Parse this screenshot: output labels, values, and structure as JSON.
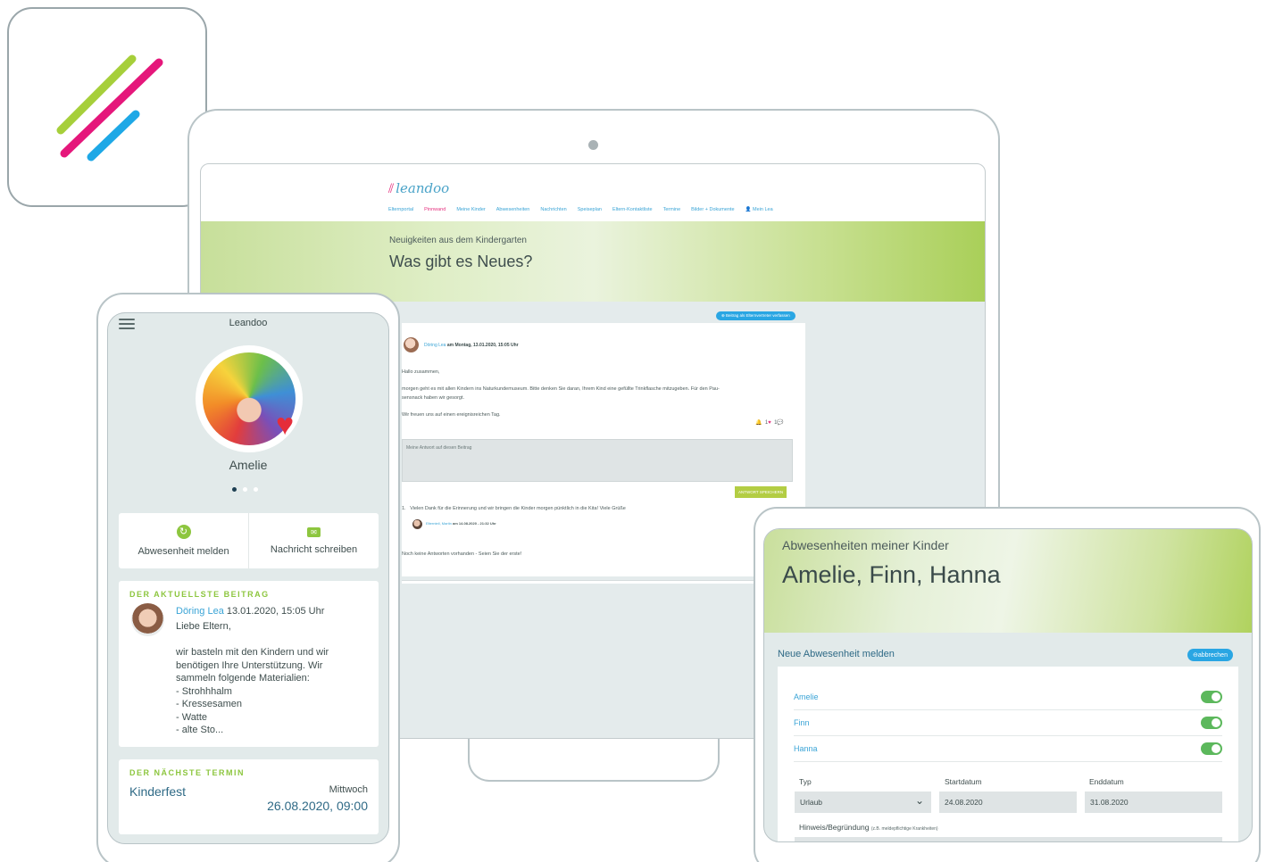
{
  "desktop": {
    "logo": "leandoo",
    "nav": [
      {
        "label": "Elternportal",
        "active": false
      },
      {
        "label": "Pinnwand",
        "active": true
      },
      {
        "label": "Meine Kinder",
        "active": false
      },
      {
        "label": "Abwesenheiten",
        "active": false
      },
      {
        "label": "Nachrichten",
        "active": false
      },
      {
        "label": "Speiseplan",
        "active": false
      },
      {
        "label": "Eltern-Kontaktliste",
        "active": false
      },
      {
        "label": "Termine",
        "active": false
      },
      {
        "label": "Bilder + Dokumente",
        "active": false
      },
      {
        "label": "Mein Lea",
        "active": false
      }
    ],
    "hero_subtitle": "Neuigkeiten aus dem Kindergarten",
    "hero_title": "Was gibt es Neues?",
    "post_button": "Beitrag als Elternvertreter verfassen",
    "post": {
      "author": "Döring Lea",
      "meta": "am Montag, 13.01.2020, 15:05 Uhr",
      "greeting": "Hallo zusammen,",
      "line1": "morgen geht es mit allen Kindern ins Naturkundemuseum. Bitte denken Sie daran, Ihrem Kind eine gefüllte Trinkflasche mitzugeben. Für den Pau-",
      "line2": "sensnack haben wir gesorgt.",
      "closing": "Wir freuen uns auf einen ereignisreichen Tag.",
      "likes": "1",
      "comments": "1"
    },
    "reply_placeholder": "Meine Antwort auf diesen Beitrag",
    "save_button": "ANTWORT SPEICHERN",
    "reply": {
      "number": "1.",
      "text": "Vielen Dank für die Erinnerung und wir bringen die Kinder morgen pünktlich in die Kita! Viele Grüße",
      "author": "Elternteil, Martin",
      "meta": "am 14.08.2020 - 21:32 Uhr"
    },
    "no_replies": "Noch keine Antworten vorhanden - Seien Sie der erste!"
  },
  "phone": {
    "title": "Leandoo",
    "child_name": "Amelie",
    "action_absence": "Abwesenheit melden",
    "action_message": "Nachricht schreiben",
    "latest_label": "DER AKTUELLSTE BEITRAG",
    "post_author": "Döring Lea",
    "post_date": "13.01.2020, 15:05 Uhr",
    "post_lines": [
      "Liebe Eltern,",
      "wir basteln mit den Kindern und wir",
      "benötigen Ihre Unterstützung. Wir",
      "sammeln folgende Materialien:",
      "- Strohhhalm",
      "- Kressesamen",
      "- Watte",
      "- alte Sto..."
    ],
    "next_label": "DER NÄCHSTE TERMIN",
    "event_title": "Kinderfest",
    "event_day": "Mittwoch",
    "event_date": "26.08.2020, 09:00"
  },
  "tablet": {
    "subtitle": "Abwesenheiten meiner Kinder",
    "title": "Amelie, Finn, Hanna",
    "section_title": "Neue Abwesenheit melden",
    "cancel": "abbrechen",
    "children": [
      {
        "name": "Amelie",
        "on": true
      },
      {
        "name": "Finn",
        "on": true
      },
      {
        "name": "Hanna",
        "on": true
      }
    ],
    "type_label": "Typ",
    "type_value": "Urlaub",
    "start_label": "Startdatum",
    "start_value": "24.08.2020",
    "end_label": "Enddatum",
    "end_value": "31.08.2020",
    "hint_label": "Hinweis/Begründung",
    "hint_small": "(z.B. meldepflichtige Krankheiten)"
  },
  "colors": {
    "brand_green": "#8dc63f",
    "brand_pink": "#e5317f",
    "brand_blue": "#2aa6e3"
  }
}
